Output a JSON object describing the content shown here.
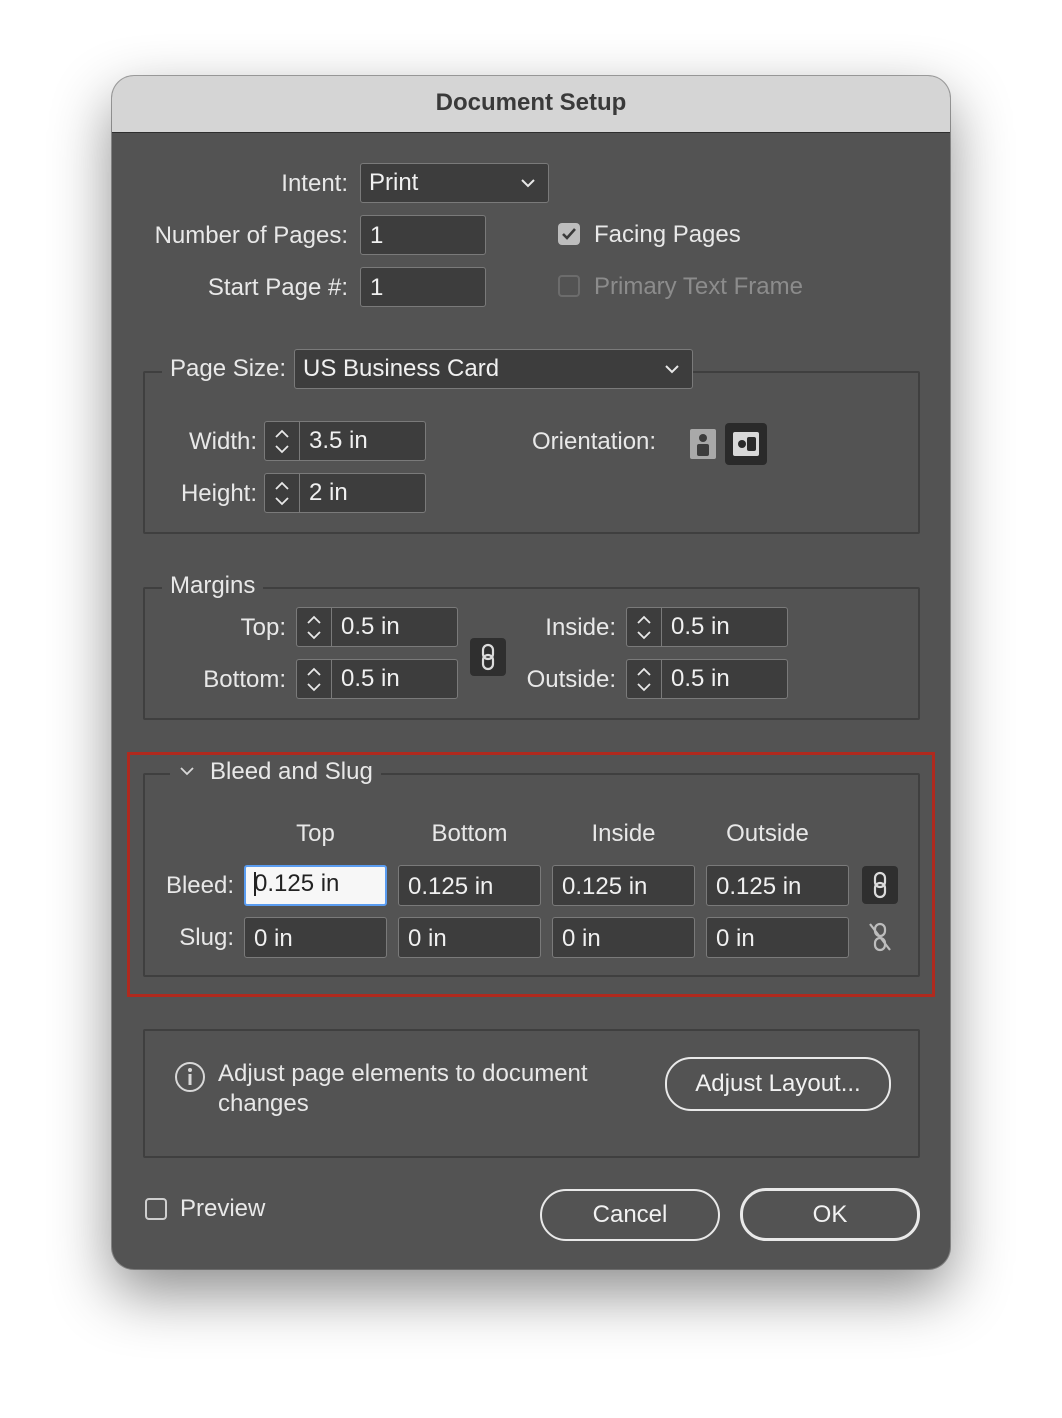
{
  "title": "Document Setup",
  "intent": {
    "label": "Intent:",
    "value": "Print"
  },
  "pages": {
    "label": "Number of Pages:",
    "value": "1"
  },
  "start_page": {
    "label": "Start Page #:",
    "value": "1"
  },
  "facing_pages": {
    "label": "Facing Pages",
    "checked": true
  },
  "primary_text_frame": {
    "label": "Primary Text Frame",
    "checked": false,
    "enabled": false
  },
  "page_size": {
    "label": "Page Size:",
    "value": "US Business Card",
    "width_label": "Width:",
    "width": "3.5 in",
    "height_label": "Height:",
    "height": "2 in",
    "orientation_label": "Orientation:",
    "orientation_icons": [
      "portrait-icon",
      "landscape-icon"
    ],
    "orientation_selected": "landscape"
  },
  "margins": {
    "legend": "Margins",
    "top_label": "Top:",
    "top": "0.5 in",
    "bottom_label": "Bottom:",
    "bottom": "0.5 in",
    "inside_label": "Inside:",
    "inside": "0.5 in",
    "outside_label": "Outside:",
    "outside": "0.5 in",
    "link_icon": "chain-link-icon"
  },
  "bleed_slug": {
    "legend": "Bleed and Slug",
    "columns": [
      "Top",
      "Bottom",
      "Inside",
      "Outside"
    ],
    "bleed_label": "Bleed:",
    "bleed": [
      "0.125 in",
      "0.125 in",
      "0.125 in",
      "0.125 in"
    ],
    "slug_label": "Slug:",
    "slug": [
      "0 in",
      "0 in",
      "0 in",
      "0 in"
    ],
    "bleed_link_icon": "chain-link-icon",
    "slug_link_icon": "broken-chain-link-icon"
  },
  "adjust": {
    "message": "Adjust page elements to document changes",
    "button": "Adjust Layout...",
    "icon": "info-icon"
  },
  "preview": {
    "label": "Preview",
    "checked": false
  },
  "cancel": "Cancel",
  "ok": "OK",
  "colors": {
    "dialog_bg": "#535353",
    "field_bg": "#3d3d3d",
    "highlight": "#b02a1e",
    "focus_ring": "#5a9cf0"
  }
}
